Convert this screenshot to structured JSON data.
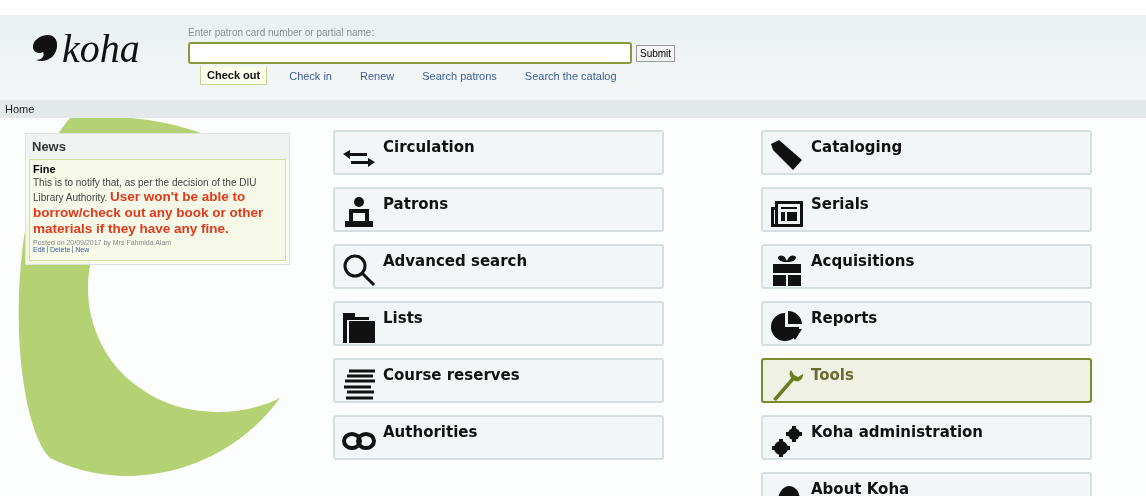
{
  "header": {
    "logo": "koha",
    "search": {
      "label": "Enter patron card number or partial name:"
    },
    "submit": "Submit",
    "tabs": [
      {
        "label": "Check out",
        "selected": true
      },
      {
        "label": "Check in",
        "selected": false
      },
      {
        "label": "Renew",
        "selected": false
      },
      {
        "label": "Search patrons",
        "selected": false
      },
      {
        "label": "Search the catalog",
        "selected": false
      }
    ]
  },
  "breadcrumb": "Home",
  "news": {
    "title": "News",
    "item_title": "Fine",
    "body": "This is to notify that, as per the decision of the DIU Library Authority. **User won't be able to borrow/check out any book or other materials if they have any fine.**",
    "posted": "Posted on 20/09/2017 by Mrs Fahmida Alam",
    "actions": [
      "Edit",
      "Delete",
      "New"
    ]
  },
  "modules_left": [
    {
      "label": "Circulation",
      "highlighted": false
    },
    {
      "label": "Patrons",
      "highlighted": false
    },
    {
      "label": "Advanced search",
      "highlighted": false
    },
    {
      "label": "Lists",
      "highlighted": false
    },
    {
      "label": "Course reserves",
      "highlighted": false
    },
    {
      "label": "Authorities",
      "highlighted": false
    }
  ],
  "modules_right": [
    {
      "label": "Cataloging",
      "highlighted": false
    },
    {
      "label": "Serials",
      "highlighted": false
    },
    {
      "label": "Acquisitions",
      "highlighted": false
    },
    {
      "label": "Reports",
      "highlighted": false
    },
    {
      "label": "Tools",
      "highlighted": true
    },
    {
      "label": "Koha administration",
      "highlighted": false
    },
    {
      "label": "About Koha",
      "highlighted": false
    }
  ]
}
